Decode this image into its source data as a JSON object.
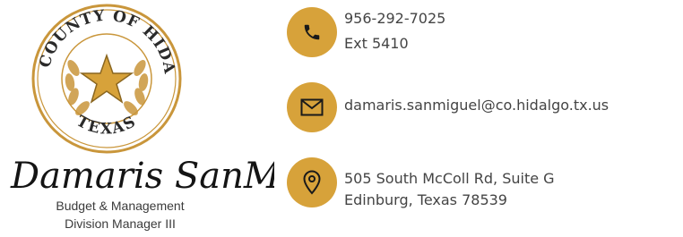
{
  "seal": {
    "top_text": "THE COUNTY OF HIDALGO",
    "bottom_text": "TEXAS",
    "ring_color": "#c9963b"
  },
  "person": {
    "signature": "Damaris SanMiguel",
    "title_line1": "Budget & Management",
    "title_line2": "Division Manager III"
  },
  "contact": {
    "phone": "956-292-7025",
    "ext": "Ext 5410",
    "email": "damaris.sanmiguel@co.hidalgo.tx.us",
    "address_line1": "505 South McColl Rd, Suite G",
    "address_line2": "Edinburg, Texas 78539",
    "icons": [
      "phone-icon",
      "envelope-icon",
      "map-pin-icon"
    ],
    "accent_color": "#d7a23a"
  }
}
